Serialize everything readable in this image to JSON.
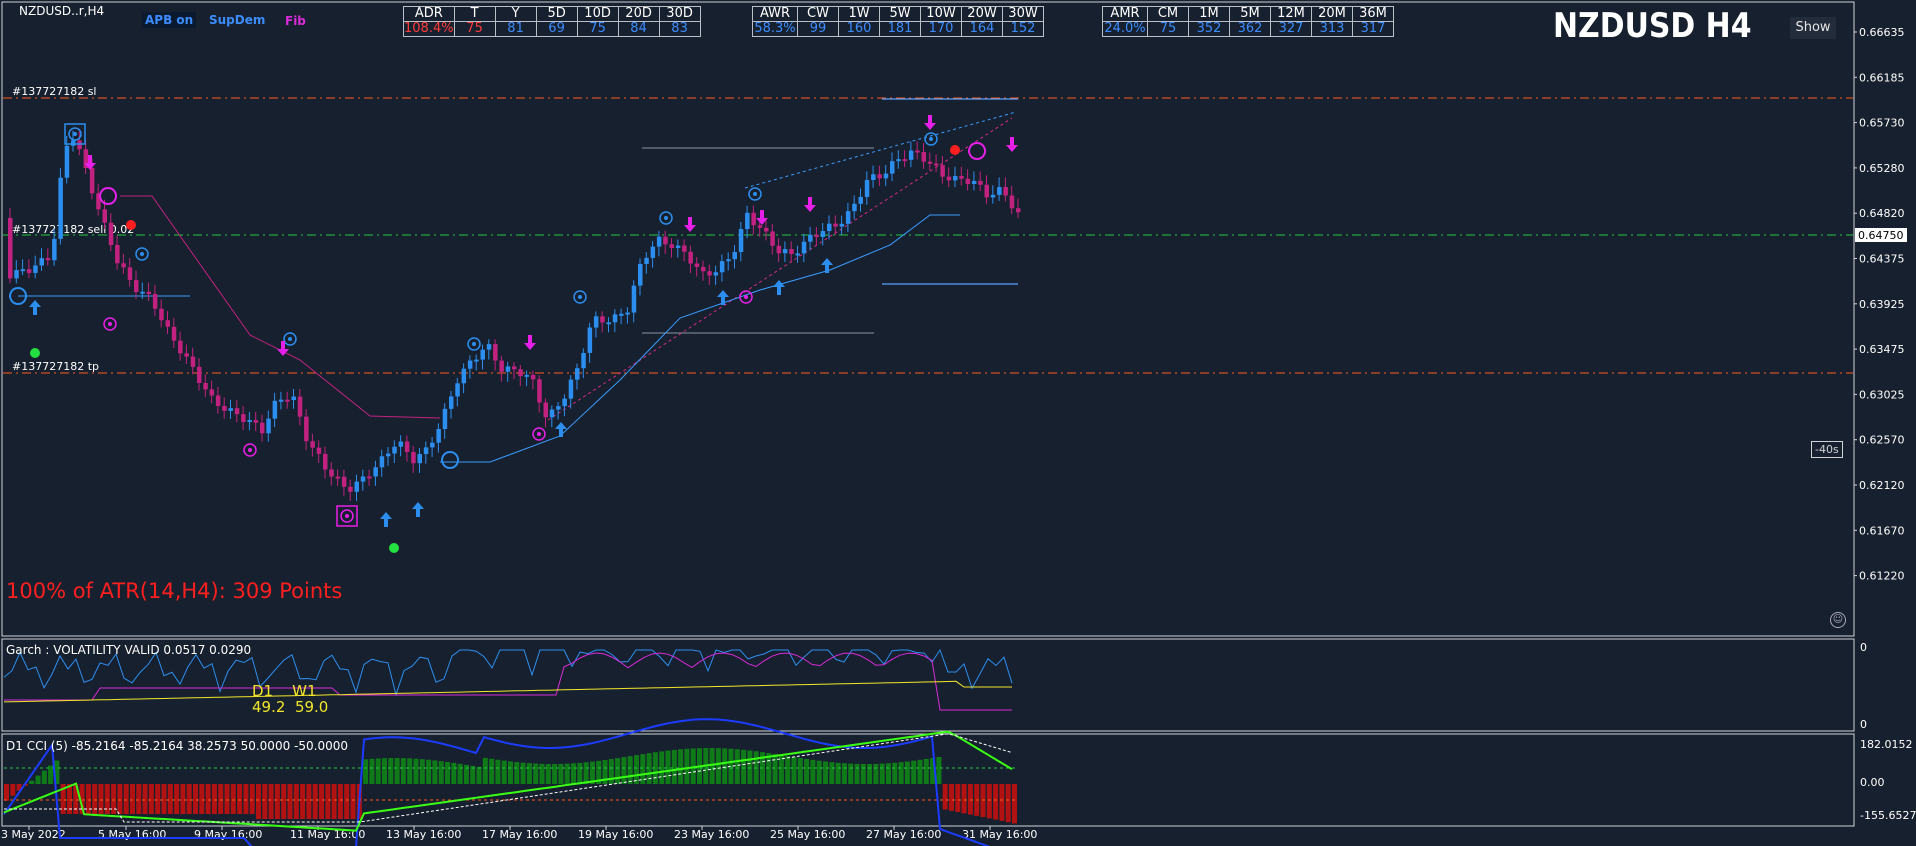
{
  "window": {
    "symbol_label": "NZDUSD..r,H4",
    "title": "NZDUSD H4",
    "show_label": "Show"
  },
  "toolbar": {
    "apb_label": "APB on",
    "supdem_label": "SupDem",
    "fib_label": "Fib"
  },
  "tables": {
    "adr": {
      "headers": [
        "ADR",
        "T",
        "Y",
        "5D",
        "10D",
        "20D",
        "30D"
      ],
      "values": [
        "108.4%",
        "75",
        "81",
        "69",
        "75",
        "84",
        "83"
      ]
    },
    "awr": {
      "headers": [
        "AWR",
        "CW",
        "1W",
        "5W",
        "10W",
        "20W",
        "30W"
      ],
      "values": [
        "58.3%",
        "99",
        "160",
        "181",
        "170",
        "164",
        "152"
      ]
    },
    "amr": {
      "headers": [
        "AMR",
        "CM",
        "1M",
        "5M",
        "12M",
        "20M",
        "36M"
      ],
      "values": [
        "24.0%",
        "75",
        "352",
        "362",
        "327",
        "313",
        "317"
      ]
    }
  },
  "price_axis": {
    "labels": [
      "0.66635",
      "0.66185",
      "0.65730",
      "0.65280",
      "0.64820",
      "0.64375",
      "0.63925",
      "0.63475",
      "0.63025",
      "0.62570",
      "0.62120",
      "0.61670",
      "0.61220"
    ],
    "current_price": "0.64750"
  },
  "order_lines": {
    "sl_label": "#137727182 sl",
    "sell_label": "#137727182 sell 0.02",
    "tp_label": "#137727182 tp"
  },
  "atr_text": "100% of ATR(14,H4): 309  Points",
  "countdown": "-40s",
  "garch": {
    "label": "Garch : VOLATILITY VALID 0.0517 0.0290",
    "scale_top": "0",
    "scale_bottom": "0",
    "d1_label": "D1",
    "w1_label": "W1",
    "d1_value": "49.2",
    "w1_value": "59.0"
  },
  "cci": {
    "label": "D1 CCI (5) -85.2164 -85.2164 38.2573 50.0000 -50.0000",
    "scale": [
      "182.0152",
      "0.00",
      "-155.6527"
    ]
  },
  "time_axis": [
    "3 May 2022",
    "5 May 16:00",
    "9 May 16:00",
    "11 May 16:00",
    "13 May 16:00",
    "17 May 16:00",
    "19 May 16:00",
    "23 May 16:00",
    "25 May 16:00",
    "27 May 16:00",
    "31 May 16:00"
  ],
  "colors": {
    "background": "#17202e",
    "bull": "#2c8ff0",
    "bear": "#c2227f",
    "sl_tp_line": "#ff5a1f",
    "entry_line": "#24c940",
    "atr_text": "#ff1f1f",
    "table_values": "#3b8cff",
    "adr_pct": "#ff3b3b"
  }
}
